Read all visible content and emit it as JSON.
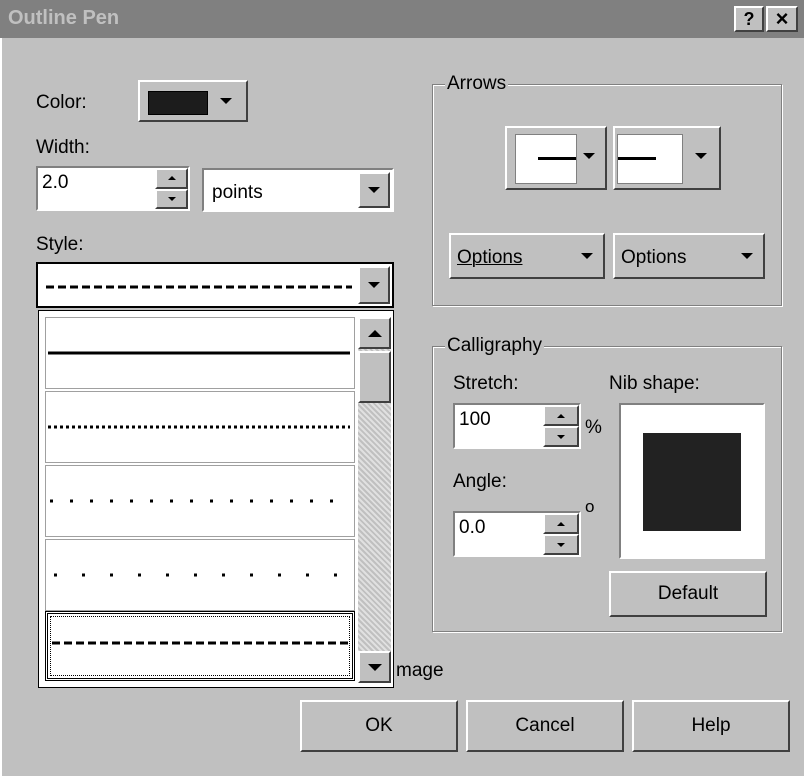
{
  "window": {
    "title": "Outline Pen",
    "help_glyph": "?",
    "close_glyph": "×"
  },
  "color": {
    "label": "Color:",
    "value": "#1c1c1c"
  },
  "width": {
    "label": "Width:",
    "value": "2.0",
    "unit": "points"
  },
  "style": {
    "label": "Style:",
    "selected_pattern": "dashed",
    "options": [
      "solid",
      "dense-dotted",
      "dotted",
      "sparse-dotted",
      "dashed"
    ]
  },
  "arrows": {
    "label": "Arrows",
    "options_left": "Options",
    "options_right": "Options"
  },
  "calligraphy": {
    "label": "Calligraphy",
    "stretch_label": "Stretch:",
    "stretch_value": "100",
    "stretch_unit": "%",
    "angle_label": "Angle:",
    "angle_value": "0.0",
    "angle_unit": "o",
    "nib_label": "Nib shape:",
    "default_label": "Default"
  },
  "image_fragment": "mage",
  "buttons": {
    "ok": "OK",
    "cancel": "Cancel",
    "help": "Help"
  }
}
